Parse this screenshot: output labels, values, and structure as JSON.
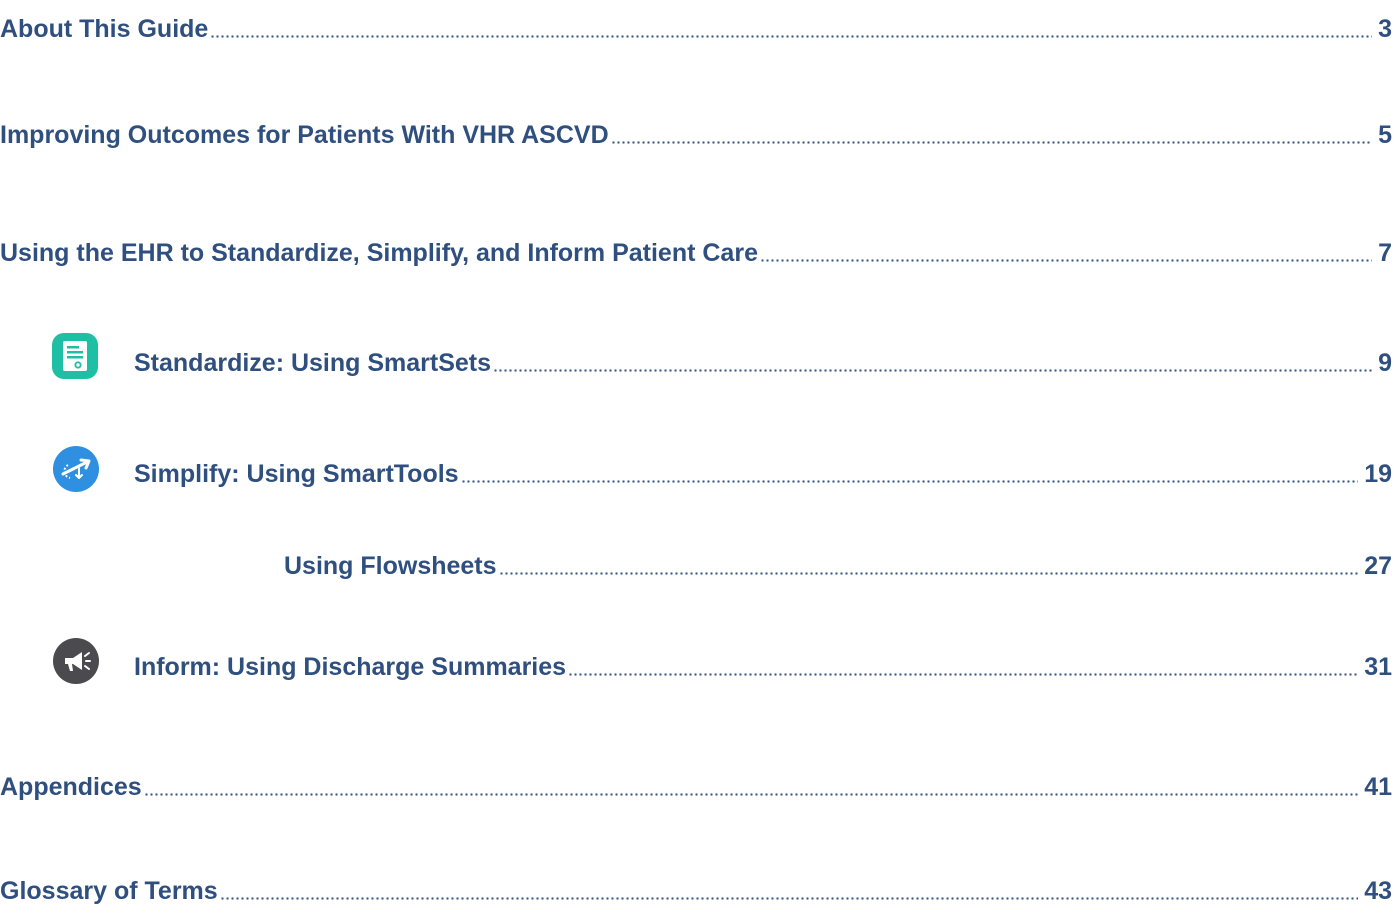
{
  "toc": {
    "entries": [
      {
        "title": "About This Guide",
        "page": "3"
      },
      {
        "title": "Improving Outcomes for Patients With VHR ASCVD",
        "page": "5"
      },
      {
        "title": "Using the EHR to Standardize, Simplify, and Inform Patient Care",
        "page": "7"
      },
      {
        "title": "Standardize: Using SmartSets",
        "page": "9",
        "icon": "document-icon",
        "icon_color": "#1ebfa5"
      },
      {
        "title": "Simplify: Using SmartTools",
        "page": "19",
        "icon": "tools-arrow-icon",
        "icon_color": "#2f8fe0"
      },
      {
        "title": "Using Flowsheets",
        "page": "27"
      },
      {
        "title": "Inform: Using Discharge Summaries",
        "page": "31",
        "icon": "megaphone-icon",
        "icon_color": "#4a4a4f"
      },
      {
        "title": "Appendices",
        "page": "41"
      },
      {
        "title": "Glossary of Terms",
        "page": "43"
      }
    ]
  },
  "colors": {
    "text": "#2f4f7f",
    "leader": "#3a5a88"
  }
}
